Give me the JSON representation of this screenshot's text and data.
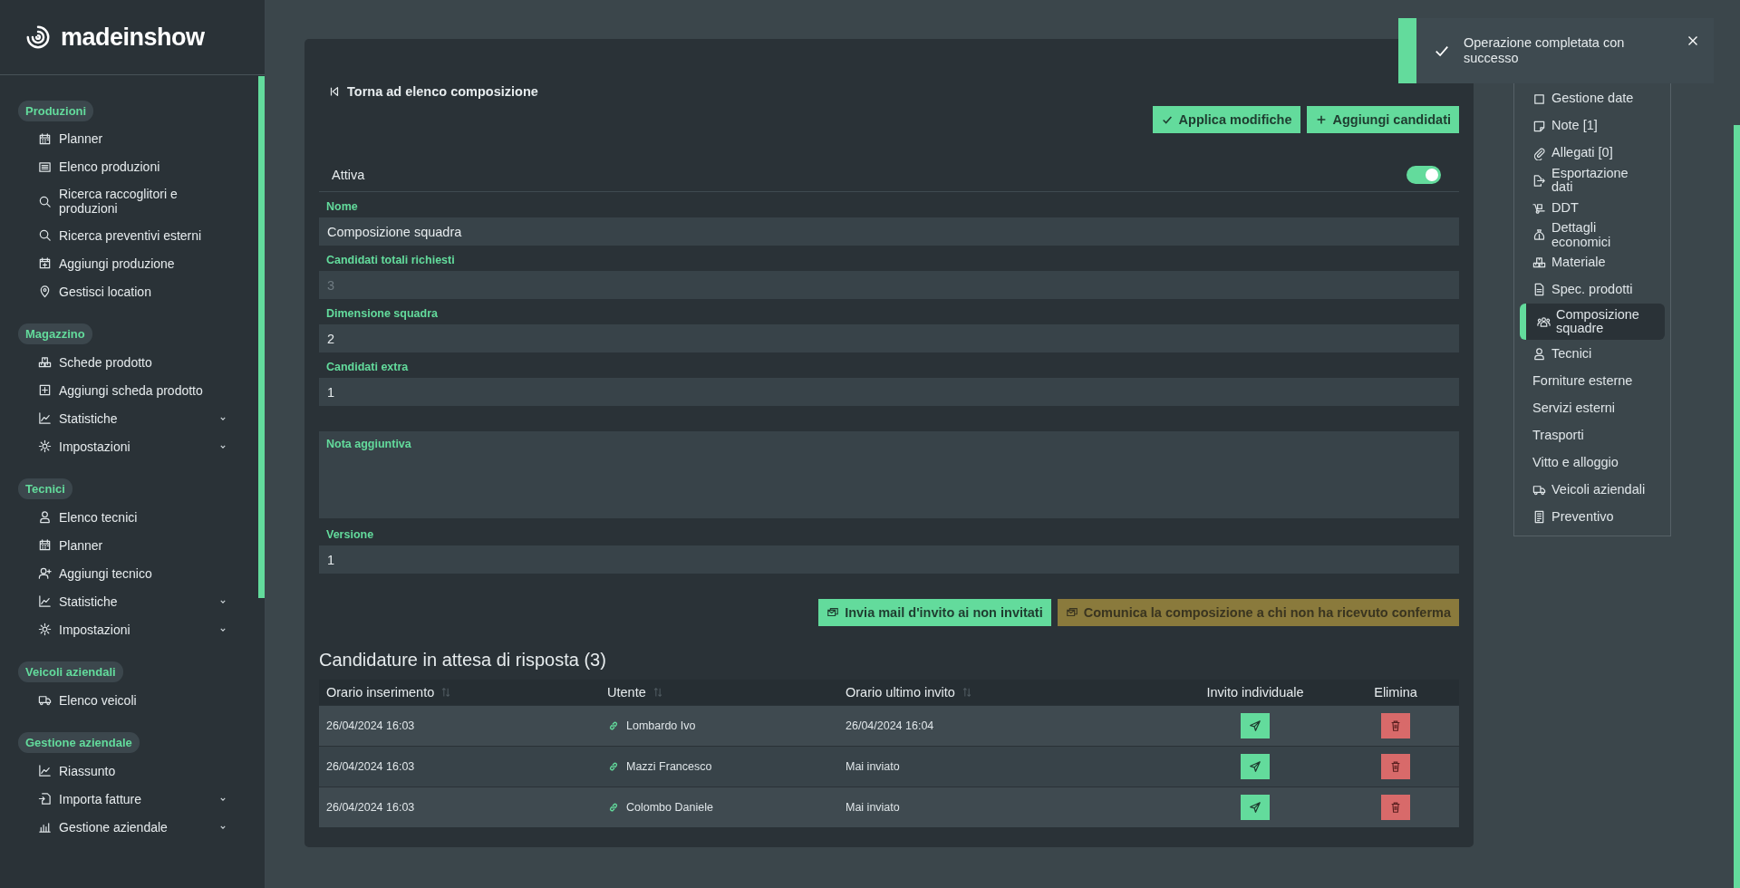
{
  "sidebar": {
    "logo": "madeinshow",
    "sections": [
      {
        "title": "Produzioni",
        "items": [
          {
            "label": "Planner",
            "expandable": false
          },
          {
            "label": "Elenco produzioni",
            "expandable": false
          },
          {
            "label": "Ricerca raccoglitori e produzioni",
            "expandable": false
          },
          {
            "label": "Ricerca preventivi esterni",
            "expandable": false
          },
          {
            "label": "Aggiungi produzione",
            "expandable": false
          },
          {
            "label": "Gestisci location",
            "expandable": false
          }
        ]
      },
      {
        "title": "Magazzino",
        "items": [
          {
            "label": "Schede prodotto",
            "expandable": false
          },
          {
            "label": "Aggiungi scheda prodotto",
            "expandable": false
          },
          {
            "label": "Statistiche",
            "expandable": true
          },
          {
            "label": "Impostazioni",
            "expandable": true
          }
        ]
      },
      {
        "title": "Tecnici",
        "items": [
          {
            "label": "Elenco tecnici",
            "expandable": false
          },
          {
            "label": "Planner",
            "expandable": false
          },
          {
            "label": "Aggiungi tecnico",
            "expandable": false
          },
          {
            "label": "Statistiche",
            "expandable": true
          },
          {
            "label": "Impostazioni",
            "expandable": true
          }
        ]
      },
      {
        "title": "Veicoli aziendali",
        "items": [
          {
            "label": "Elenco veicoli",
            "expandable": false
          }
        ]
      },
      {
        "title": "Gestione aziendale",
        "items": [
          {
            "label": "Riassunto",
            "expandable": false
          },
          {
            "label": "Importa fatture",
            "expandable": true
          },
          {
            "label": "Gestione aziendale",
            "expandable": true
          }
        ]
      }
    ]
  },
  "form": {
    "back_link": "Torna ad elenco composizione",
    "actions": [
      "Applica modifiche",
      "Aggiungi candidati"
    ],
    "toggle": {
      "label": "Attiva",
      "on": true
    },
    "fields": [
      {
        "label": "Nome",
        "value": "Composizione squadra",
        "disabled": false,
        "kind": "input"
      },
      {
        "label": "Candidati totali richiesti",
        "value": "3",
        "disabled": true,
        "kind": "input"
      },
      {
        "label": "Dimensione squadra",
        "value": "2",
        "disabled": false,
        "kind": "input"
      },
      {
        "label": "Candidati extra",
        "value": "1",
        "disabled": false,
        "kind": "input"
      },
      {
        "label": "Nota aggiuntiva",
        "kind": "textarea"
      },
      {
        "label": "Versione",
        "value": "1",
        "disabled": false,
        "kind": "input"
      }
    ],
    "mail_buttons": [
      {
        "label": "Invia mail d'invito ai non invitati",
        "kind": "primary"
      },
      {
        "label": "Comunica la composizione a chi non ha ricevuto conferma",
        "kind": "warning"
      }
    ]
  },
  "table": {
    "title": "Candidature in attesa di risposta (3)",
    "columns": [
      {
        "label": "Orario inserimento",
        "sortable": true
      },
      {
        "label": "Utente",
        "sortable": true
      },
      {
        "label": "Orario ultimo invito",
        "sortable": true
      },
      {
        "label": "Invito individuale",
        "sortable": false
      },
      {
        "label": "Elimina",
        "sortable": false
      }
    ],
    "rows": [
      {
        "inserted": "26/04/2024 16:03",
        "user": "Lombardo Ivo",
        "last_invite": "26/04/2024 16:04"
      },
      {
        "inserted": "26/04/2024 16:03",
        "user": "Mazzi Francesco",
        "last_invite": "Mai inviato"
      },
      {
        "inserted": "26/04/2024 16:03",
        "user": "Colombo Daniele",
        "last_invite": "Mai inviato"
      }
    ]
  },
  "section_nav": {
    "items": [
      {
        "label": "Gestione date",
        "selected": false
      },
      {
        "label": "Note [1]",
        "selected": false
      },
      {
        "label": "Allegati [0]",
        "selected": false
      },
      {
        "label": "Esportazione dati",
        "selected": false
      },
      {
        "label": "DDT",
        "selected": false
      },
      {
        "label": "Dettagli economici",
        "selected": false
      },
      {
        "label": "Materiale",
        "selected": false
      },
      {
        "label": "Spec. prodotti",
        "selected": false
      },
      {
        "label": "Composizione squadre",
        "selected": true
      },
      {
        "label": "Tecnici",
        "selected": false
      },
      {
        "label": "Forniture esterne",
        "selected": false
      },
      {
        "label": "Servizi esterni",
        "selected": false
      },
      {
        "label": "Trasporti",
        "selected": false
      },
      {
        "label": "Vitto e alloggio",
        "selected": false
      },
      {
        "label": "Veicoli aziendali",
        "selected": false
      },
      {
        "label": "Preventivo",
        "selected": false
      }
    ]
  },
  "toast": {
    "message": "Operazione completata con successo"
  }
}
